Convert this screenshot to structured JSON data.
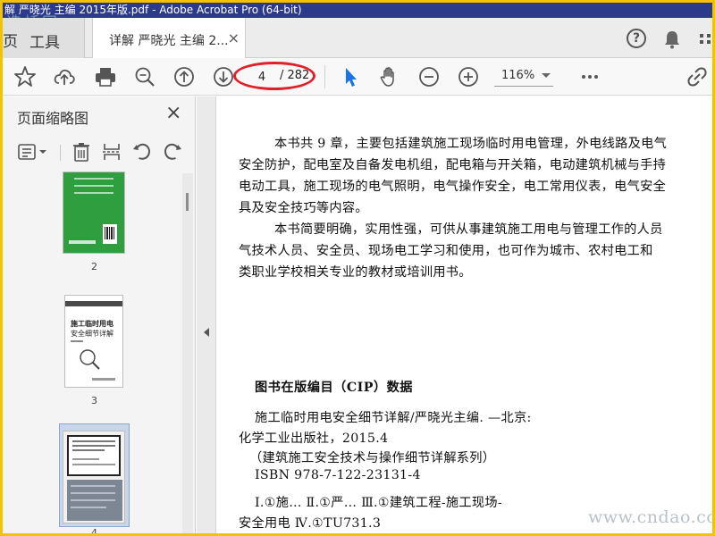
{
  "app": {
    "window_title": "解 严晓光 主编 2015年版.pdf - Adobe Acrobat Pro (64-bit)",
    "watermark_top": "造桥网",
    "watermark_bottom": "www.cndao.com"
  },
  "tabs": {
    "tools_edge": "页",
    "tools_label": "工具",
    "doc_label": "详解 严晓光 主编 2...",
    "close_symbol": "×",
    "help_symbol": "?"
  },
  "toolbar": {
    "current_page": "4",
    "page_total": "/ 282",
    "zoom": "116%"
  },
  "panel": {
    "title": "页面缩略图",
    "close_symbol": "×",
    "thumbnails": [
      {
        "label": "2",
        "selected": false
      },
      {
        "label": "3",
        "selected": false,
        "title_line1": "施工临时用电",
        "title_line2": "安全细节详解"
      },
      {
        "label": "4",
        "selected": true
      }
    ]
  },
  "document": {
    "para1": [
      "本书共 9 章，主要包括建筑施工现场临时用电管理，外电线路及电气",
      "安全防护，配电室及自备发电机组，配电箱与开关箱，电动建筑机械与手持",
      "电动工具，施工现场的电气照明，电气操作安全，电工常用仪表，电气安全",
      "具及安全技巧等内容。"
    ],
    "para2": [
      "本书简要明确，实用性强，可供从事建筑施工用电与管理工作的人员",
      "气技术人员、安全员、现场电工学习和使用，也可作为城市、农村电工和",
      "类职业学校相关专业的教材或培训用书。"
    ],
    "cip_title": "图书在版编目（CIP）数据",
    "cip_lines": [
      "施工临时用电安全细节详解/严晓光主编. —北京:",
      "化学工业出版社，2015.4",
      "（建筑施工安全技术与操作细节详解系列）",
      "ISBN 978-7-122-23131-4",
      "Ⅰ.①施…  Ⅱ.①严…  Ⅲ.①建筑工程-施工现场-",
      "安全用电  Ⅳ.①TU731.3"
    ]
  },
  "colors": {
    "title_bar": "#2b3a8a",
    "frame": "#f2c400",
    "annotation_oval": "#e0202a",
    "cursor_blue": "#1a73e8",
    "green_cover": "#2e9e3e"
  }
}
